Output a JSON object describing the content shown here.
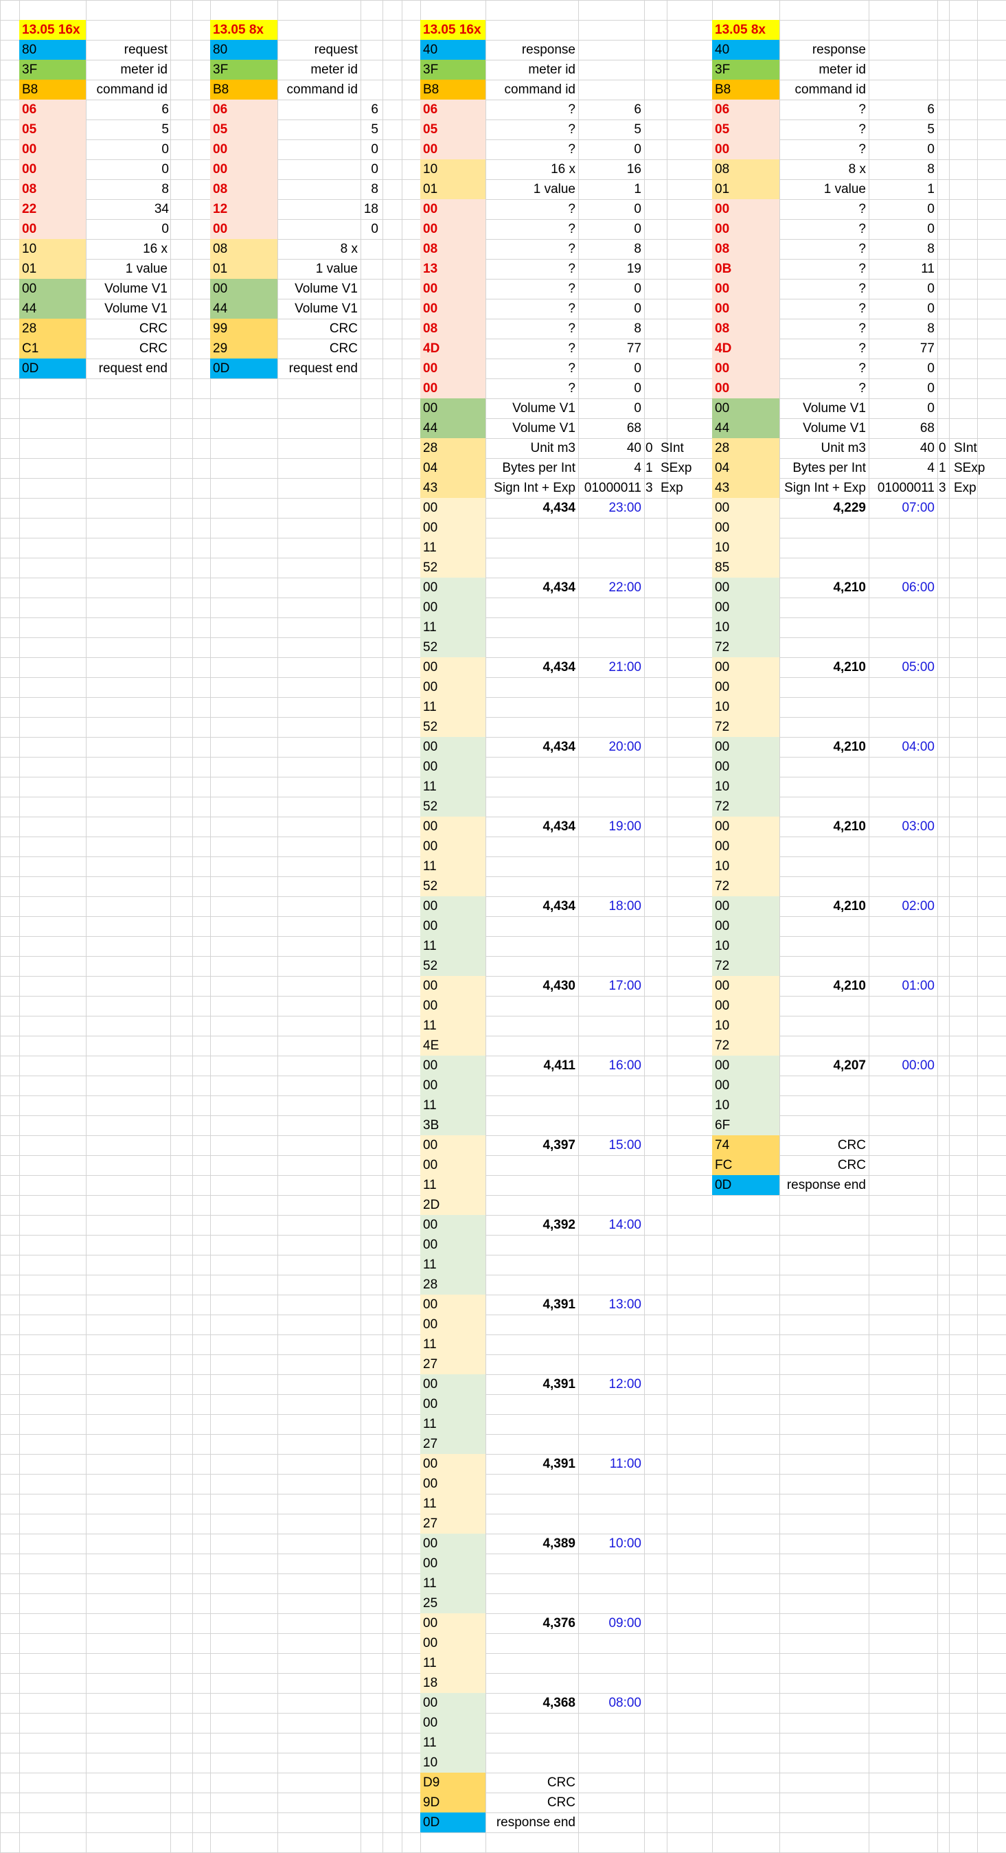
{
  "colors": {
    "yellow": "#ffff00",
    "blue": "#00b0f0",
    "green": "#92d050",
    "orange": "#ffc000",
    "pink": "#fde4d8",
    "lightorange": "#ffe699",
    "olive": "#a9d08e",
    "gold": "#ffd966",
    "cream": "#fff2cc",
    "mint": "#e2efda",
    "red": "#e00000",
    "hourblue": "#1a1adc"
  },
  "tables": [
    {
      "title": "13.05 16x",
      "rows": [
        {
          "hex": "80",
          "color": "blue",
          "label": "request",
          "val": ""
        },
        {
          "hex": "3F",
          "color": "green",
          "label": "meter id",
          "val": ""
        },
        {
          "hex": "B8",
          "color": "orange",
          "label": "command id",
          "val": ""
        },
        {
          "hex": "06",
          "color": "pink",
          "red": true,
          "label": "",
          "val": "6"
        },
        {
          "hex": "05",
          "color": "pink",
          "red": true,
          "label": "",
          "val": "5"
        },
        {
          "hex": "00",
          "color": "pink",
          "red": true,
          "label": "",
          "val": "0"
        },
        {
          "hex": "00",
          "color": "pink",
          "red": true,
          "label": "",
          "val": "0"
        },
        {
          "hex": "08",
          "color": "pink",
          "red": true,
          "label": "",
          "val": "8"
        },
        {
          "hex": "22",
          "color": "pink",
          "red": true,
          "label": "",
          "val": "34"
        },
        {
          "hex": "00",
          "color": "pink",
          "red": true,
          "label": "",
          "val": "0"
        },
        {
          "hex": "10",
          "color": "lightorange",
          "label": "16 x",
          "val": ""
        },
        {
          "hex": "01",
          "color": "lightorange",
          "label": "1 value",
          "val": ""
        },
        {
          "hex": "00",
          "color": "olive",
          "label": "Volume V1",
          "val": ""
        },
        {
          "hex": "44",
          "color": "olive",
          "label": "Volume V1",
          "val": ""
        },
        {
          "hex": "28",
          "color": "gold",
          "label": "CRC",
          "val": ""
        },
        {
          "hex": "C1",
          "color": "gold",
          "label": "CRC",
          "val": ""
        },
        {
          "hex": "0D",
          "color": "blue",
          "label": "request end",
          "val": ""
        }
      ]
    },
    {
      "title": "13.05 8x",
      "rows": [
        {
          "hex": "80",
          "color": "blue",
          "label": "request",
          "val": ""
        },
        {
          "hex": "3F",
          "color": "green",
          "label": "meter id",
          "val": ""
        },
        {
          "hex": "B8",
          "color": "orange",
          "label": "command id",
          "val": ""
        },
        {
          "hex": "06",
          "color": "pink",
          "red": true,
          "label": "",
          "val": "6"
        },
        {
          "hex": "05",
          "color": "pink",
          "red": true,
          "label": "",
          "val": "5"
        },
        {
          "hex": "00",
          "color": "pink",
          "red": true,
          "label": "",
          "val": "0"
        },
        {
          "hex": "00",
          "color": "pink",
          "red": true,
          "label": "",
          "val": "0"
        },
        {
          "hex": "08",
          "color": "pink",
          "red": true,
          "label": "",
          "val": "8"
        },
        {
          "hex": "12",
          "color": "pink",
          "red": true,
          "label": "",
          "val": "18"
        },
        {
          "hex": "00",
          "color": "pink",
          "red": true,
          "label": "",
          "val": "0"
        },
        {
          "hex": "08",
          "color": "lightorange",
          "label": "8 x",
          "val": ""
        },
        {
          "hex": "01",
          "color": "lightorange",
          "label": "1 value",
          "val": ""
        },
        {
          "hex": "00",
          "color": "olive",
          "label": "Volume V1",
          "val": ""
        },
        {
          "hex": "44",
          "color": "olive",
          "label": "Volume V1",
          "val": ""
        },
        {
          "hex": "99",
          "color": "gold",
          "label": "CRC",
          "val": ""
        },
        {
          "hex": "29",
          "color": "gold",
          "label": "CRC",
          "val": ""
        },
        {
          "hex": "0D",
          "color": "blue",
          "label": "request end",
          "val": ""
        }
      ]
    },
    {
      "title": "13.05 16x",
      "rows": [
        {
          "hex": "40",
          "color": "blue",
          "label": "response",
          "val": ""
        },
        {
          "hex": "3F",
          "color": "green",
          "label": "meter id",
          "val": ""
        },
        {
          "hex": "B8",
          "color": "orange",
          "label": "command id",
          "val": ""
        },
        {
          "hex": "06",
          "color": "pink",
          "red": true,
          "label": "?",
          "val": "6"
        },
        {
          "hex": "05",
          "color": "pink",
          "red": true,
          "label": "?",
          "val": "5"
        },
        {
          "hex": "00",
          "color": "pink",
          "red": true,
          "label": "?",
          "val": "0"
        },
        {
          "hex": "10",
          "color": "lightorange",
          "label": "16 x",
          "val": "16"
        },
        {
          "hex": "01",
          "color": "lightorange",
          "label": "1 value",
          "val": "1"
        },
        {
          "hex": "00",
          "color": "pink",
          "red": true,
          "label": "?",
          "val": "0"
        },
        {
          "hex": "00",
          "color": "pink",
          "red": true,
          "label": "?",
          "val": "0"
        },
        {
          "hex": "08",
          "color": "pink",
          "red": true,
          "label": "?",
          "val": "8"
        },
        {
          "hex": "13",
          "color": "pink",
          "red": true,
          "label": "?",
          "val": "19"
        },
        {
          "hex": "00",
          "color": "pink",
          "red": true,
          "label": "?",
          "val": "0"
        },
        {
          "hex": "00",
          "color": "pink",
          "red": true,
          "label": "?",
          "val": "0"
        },
        {
          "hex": "08",
          "color": "pink",
          "red": true,
          "label": "?",
          "val": "8"
        },
        {
          "hex": "4D",
          "color": "pink",
          "red": true,
          "label": "?",
          "val": "77"
        },
        {
          "hex": "00",
          "color": "pink",
          "red": true,
          "label": "?",
          "val": "0"
        },
        {
          "hex": "00",
          "color": "pink",
          "red": true,
          "label": "?",
          "val": "0"
        },
        {
          "hex": "00",
          "color": "olive",
          "label": "Volume V1",
          "val": "0"
        },
        {
          "hex": "44",
          "color": "olive",
          "label": "Volume V1",
          "val": "68"
        },
        {
          "hex": "28",
          "color": "lightorange",
          "label": "Unit m3",
          "val": "40",
          "x1": "0",
          "x2": "SInt"
        },
        {
          "hex": "04",
          "color": "lightorange",
          "label": "Bytes per Int",
          "val": "4",
          "x1": "1",
          "x2": "SExp"
        },
        {
          "hex": "43",
          "color": "lightorange",
          "label": "Sign Int + Exp",
          "val": "01000011",
          "x1": "3",
          "x2": "Exp"
        }
      ],
      "groups": [
        {
          "hex": [
            "00",
            "00",
            "11",
            "52"
          ],
          "value": "4,434",
          "hour": "23:00"
        },
        {
          "hex": [
            "00",
            "00",
            "11",
            "52"
          ],
          "value": "4,434",
          "hour": "22:00"
        },
        {
          "hex": [
            "00",
            "00",
            "11",
            "52"
          ],
          "value": "4,434",
          "hour": "21:00"
        },
        {
          "hex": [
            "00",
            "00",
            "11",
            "52"
          ],
          "value": "4,434",
          "hour": "20:00"
        },
        {
          "hex": [
            "00",
            "00",
            "11",
            "52"
          ],
          "value": "4,434",
          "hour": "19:00"
        },
        {
          "hex": [
            "00",
            "00",
            "11",
            "52"
          ],
          "value": "4,434",
          "hour": "18:00"
        },
        {
          "hex": [
            "00",
            "00",
            "11",
            "4E"
          ],
          "value": "4,430",
          "hour": "17:00"
        },
        {
          "hex": [
            "00",
            "00",
            "11",
            "3B"
          ],
          "value": "4,411",
          "hour": "16:00"
        },
        {
          "hex": [
            "00",
            "00",
            "11",
            "2D"
          ],
          "value": "4,397",
          "hour": "15:00"
        },
        {
          "hex": [
            "00",
            "00",
            "11",
            "28"
          ],
          "value": "4,392",
          "hour": "14:00"
        },
        {
          "hex": [
            "00",
            "00",
            "11",
            "27"
          ],
          "value": "4,391",
          "hour": "13:00"
        },
        {
          "hex": [
            "00",
            "00",
            "11",
            "27"
          ],
          "value": "4,391",
          "hour": "12:00"
        },
        {
          "hex": [
            "00",
            "00",
            "11",
            "27"
          ],
          "value": "4,391",
          "hour": "11:00"
        },
        {
          "hex": [
            "00",
            "00",
            "11",
            "25"
          ],
          "value": "4,389",
          "hour": "10:00"
        },
        {
          "hex": [
            "00",
            "00",
            "11",
            "18"
          ],
          "value": "4,376",
          "hour": "09:00"
        },
        {
          "hex": [
            "00",
            "00",
            "11",
            "10"
          ],
          "value": "4,368",
          "hour": "08:00"
        }
      ],
      "footer": [
        {
          "hex": "D9",
          "color": "gold",
          "label": "CRC"
        },
        {
          "hex": "9D",
          "color": "gold",
          "label": "CRC"
        },
        {
          "hex": "0D",
          "color": "blue",
          "label": "response end"
        }
      ]
    },
    {
      "title": "13.05 8x",
      "rows": [
        {
          "hex": "40",
          "color": "blue",
          "label": "response",
          "val": ""
        },
        {
          "hex": "3F",
          "color": "green",
          "label": "meter id",
          "val": ""
        },
        {
          "hex": "B8",
          "color": "orange",
          "label": "command id",
          "val": ""
        },
        {
          "hex": "06",
          "color": "pink",
          "red": true,
          "label": "?",
          "val": "6"
        },
        {
          "hex": "05",
          "color": "pink",
          "red": true,
          "label": "?",
          "val": "5"
        },
        {
          "hex": "00",
          "color": "pink",
          "red": true,
          "label": "?",
          "val": "0"
        },
        {
          "hex": "08",
          "color": "lightorange",
          "label": "8 x",
          "val": "8"
        },
        {
          "hex": "01",
          "color": "lightorange",
          "label": "1 value",
          "val": "1"
        },
        {
          "hex": "00",
          "color": "pink",
          "red": true,
          "label": "?",
          "val": "0"
        },
        {
          "hex": "00",
          "color": "pink",
          "red": true,
          "label": "?",
          "val": "0"
        },
        {
          "hex": "08",
          "color": "pink",
          "red": true,
          "label": "?",
          "val": "8"
        },
        {
          "hex": "0B",
          "color": "pink",
          "red": true,
          "label": "?",
          "val": "11"
        },
        {
          "hex": "00",
          "color": "pink",
          "red": true,
          "label": "?",
          "val": "0"
        },
        {
          "hex": "00",
          "color": "pink",
          "red": true,
          "label": "?",
          "val": "0"
        },
        {
          "hex": "08",
          "color": "pink",
          "red": true,
          "label": "?",
          "val": "8"
        },
        {
          "hex": "4D",
          "color": "pink",
          "red": true,
          "label": "?",
          "val": "77"
        },
        {
          "hex": "00",
          "color": "pink",
          "red": true,
          "label": "?",
          "val": "0"
        },
        {
          "hex": "00",
          "color": "pink",
          "red": true,
          "label": "?",
          "val": "0"
        },
        {
          "hex": "00",
          "color": "olive",
          "label": "Volume V1",
          "val": "0"
        },
        {
          "hex": "44",
          "color": "olive",
          "label": "Volume V1",
          "val": "68"
        },
        {
          "hex": "28",
          "color": "lightorange",
          "label": "Unit m3",
          "val": "40",
          "x1": "0",
          "x2": "SInt"
        },
        {
          "hex": "04",
          "color": "lightorange",
          "label": "Bytes per Int",
          "val": "4",
          "x1": "1",
          "x2": "SExp"
        },
        {
          "hex": "43",
          "color": "lightorange",
          "label": "Sign Int + Exp",
          "val": "01000011",
          "x1": "3",
          "x2": "Exp"
        }
      ],
      "groups": [
        {
          "hex": [
            "00",
            "00",
            "10",
            "85"
          ],
          "value": "4,229",
          "hour": "07:00"
        },
        {
          "hex": [
            "00",
            "00",
            "10",
            "72"
          ],
          "value": "4,210",
          "hour": "06:00"
        },
        {
          "hex": [
            "00",
            "00",
            "10",
            "72"
          ],
          "value": "4,210",
          "hour": "05:00"
        },
        {
          "hex": [
            "00",
            "00",
            "10",
            "72"
          ],
          "value": "4,210",
          "hour": "04:00"
        },
        {
          "hex": [
            "00",
            "00",
            "10",
            "72"
          ],
          "value": "4,210",
          "hour": "03:00"
        },
        {
          "hex": [
            "00",
            "00",
            "10",
            "72"
          ],
          "value": "4,210",
          "hour": "02:00"
        },
        {
          "hex": [
            "00",
            "00",
            "10",
            "72"
          ],
          "value": "4,210",
          "hour": "01:00"
        },
        {
          "hex": [
            "00",
            "00",
            "10",
            "6F"
          ],
          "value": "4,207",
          "hour": "00:00"
        }
      ],
      "footer": [
        {
          "hex": "74",
          "color": "gold",
          "label": "CRC"
        },
        {
          "hex": "FC",
          "color": "gold",
          "label": "CRC"
        },
        {
          "hex": "0D",
          "color": "blue",
          "label": "response end"
        }
      ]
    }
  ]
}
